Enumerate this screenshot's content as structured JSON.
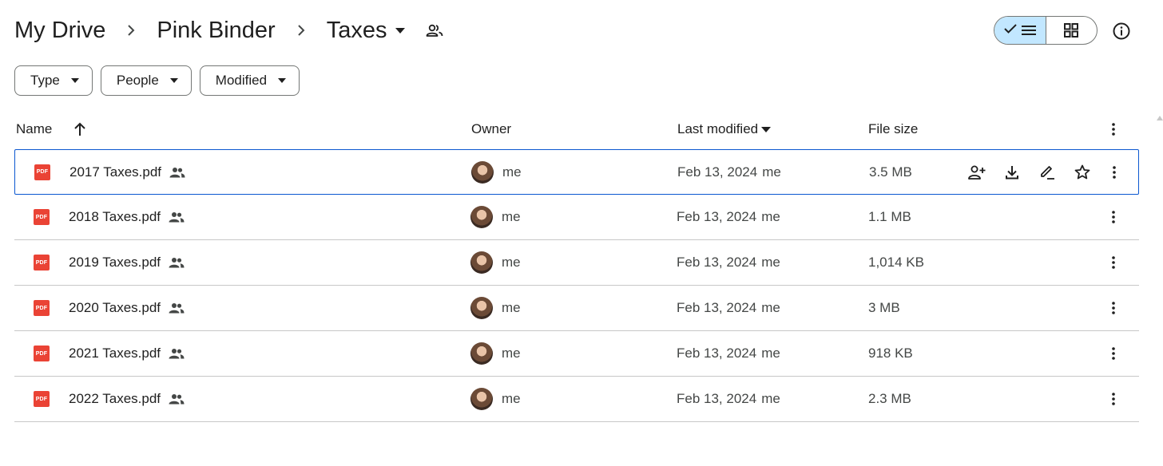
{
  "breadcrumb": {
    "items": [
      "My Drive",
      "Pink Binder"
    ],
    "current": "Taxes"
  },
  "view": {
    "selected": "list",
    "icons": [
      "check-icon",
      "list-icon",
      "grid-icon",
      "info-icon"
    ]
  },
  "filters": [
    "Type",
    "People",
    "Modified"
  ],
  "columns": {
    "name": "Name",
    "owner": "Owner",
    "modified": "Last modified",
    "size": "File size"
  },
  "files": [
    {
      "name": "2017 Taxes.pdf",
      "owner": "me",
      "modified": "Feb 13, 2024",
      "modified_by": "me",
      "size": "3.5 MB"
    },
    {
      "name": "2018 Taxes.pdf",
      "owner": "me",
      "modified": "Feb 13, 2024",
      "modified_by": "me",
      "size": "1.1 MB"
    },
    {
      "name": "2019 Taxes.pdf",
      "owner": "me",
      "modified": "Feb 13, 2024",
      "modified_by": "me",
      "size": "1,014 KB"
    },
    {
      "name": "2020 Taxes.pdf",
      "owner": "me",
      "modified": "Feb 13, 2024",
      "modified_by": "me",
      "size": "3 MB"
    },
    {
      "name": "2021 Taxes.pdf",
      "owner": "me",
      "modified": "Feb 13, 2024",
      "modified_by": "me",
      "size": "918 KB"
    },
    {
      "name": "2022 Taxes.pdf",
      "owner": "me",
      "modified": "Feb 13, 2024",
      "modified_by": "me",
      "size": "2.3 MB"
    }
  ],
  "file_badge": "PDF",
  "selected_row_actions": [
    "share-icon",
    "download-icon",
    "rename-icon",
    "star-icon"
  ],
  "colors": {
    "accent": "#0b57d0",
    "toggle_bg": "#c2e7ff",
    "pdf_red": "#ea4335"
  }
}
